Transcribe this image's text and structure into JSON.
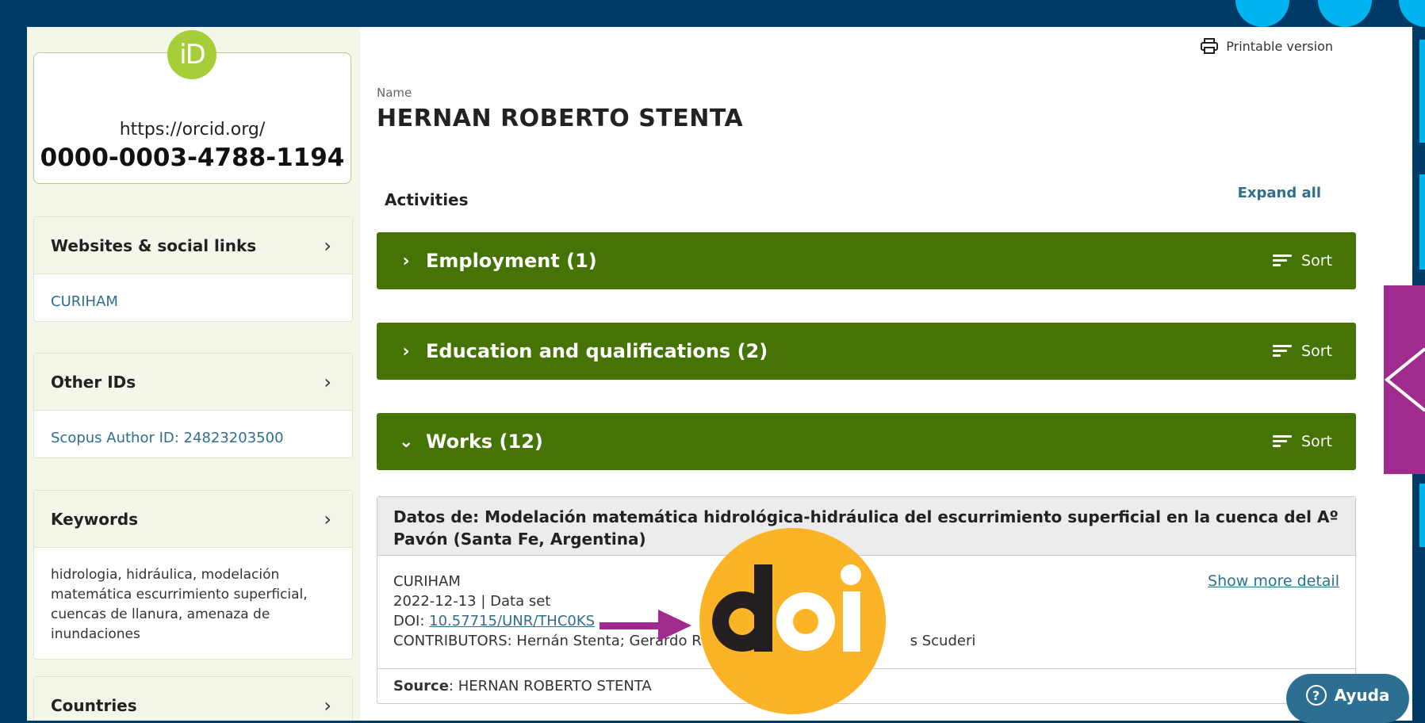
{
  "orcid": {
    "logo_text": "iD",
    "url": "https://orcid.org/",
    "id": "0000-0003-4788-1194"
  },
  "sidebar": {
    "panels": [
      {
        "title": "Websites & social links",
        "content": "CURIHAM"
      },
      {
        "title": "Other IDs",
        "content": "Scopus Author ID: 24823203500"
      },
      {
        "title": "Keywords",
        "content": "hidrologia, hidráulica, modelación matemática escurrimiento superficial, cuencas de llanura, amenaza de inundaciones"
      },
      {
        "title": "Countries",
        "content": ""
      }
    ],
    "chevron": "›"
  },
  "header": {
    "printable_label": "Printable version",
    "name_label": "Name",
    "name_value": "HERNAN ROBERTO STENTA"
  },
  "activities": {
    "title": "Activities",
    "expand_all": "Expand all",
    "sort_label": "Sort",
    "sections": [
      {
        "label": "Employment (1)",
        "chevron": "›",
        "expanded": false
      },
      {
        "label": "Education and qualifications (2)",
        "chevron": "›",
        "expanded": false
      },
      {
        "label": "Works (12)",
        "chevron": "⌄",
        "expanded": true
      }
    ]
  },
  "work": {
    "title": "Datos de: Modelación matemática hidrológica-hidráulica del escurrimiento superficial en la cuenca del Aº Pavón (Santa Fe, Argentina)",
    "org": "CURIHAM",
    "date_type": "2022-12-13 | Data set",
    "doi_prefix": "DOI: ",
    "doi": "10.57715/UNR/THC0KS",
    "contributors_start": "CONTRIBUTORS: Hernán Stenta; Gerardo Ric",
    "contributors_end": "s Scuderi",
    "show_more": "Show more detail",
    "source_label": "Source",
    "source_value": ": HERNAN ROBERTO STENTA"
  },
  "overlay": {
    "doi_logo_text": "doi"
  },
  "help": {
    "icon_text": "?",
    "label": "Ayuda"
  },
  "colors": {
    "background": "#003a66",
    "section_green": "#457405",
    "orcid_green": "#a6ce39",
    "link_blue": "#2e6f8e",
    "accent_purple": "#a02b8f",
    "doi_orange": "#fcb426",
    "accent_cyan": "#00b4f0"
  }
}
